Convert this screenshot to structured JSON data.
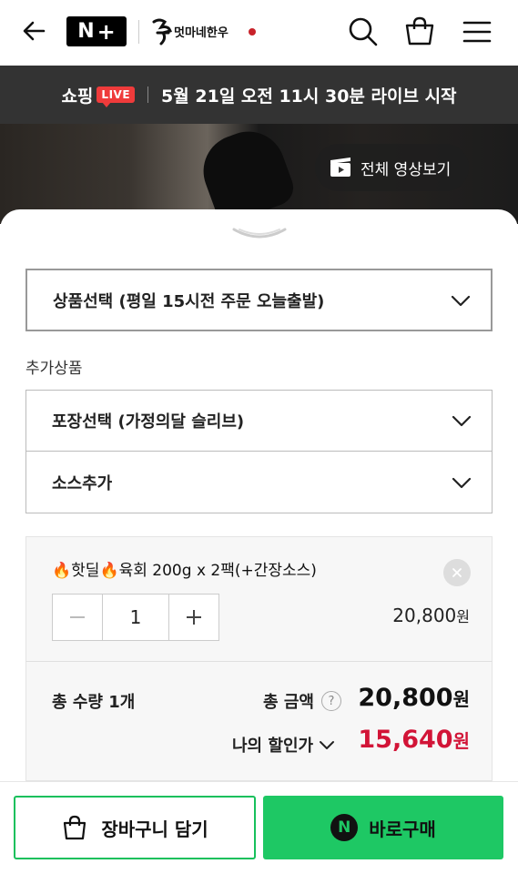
{
  "header": {
    "npay_n": "N",
    "npay_plus": "+",
    "brand_logo_text": "멋마네한우",
    "icons": [
      "back-arrow-icon",
      "search-icon",
      "shopping-bag-icon",
      "hamburger-menu-icon"
    ]
  },
  "live_banner": {
    "shop_label": "쇼핑",
    "live_badge": "LIVE",
    "schedule_text": "5월 21일 오전 11시 30분 라이브 시작"
  },
  "video": {
    "watch_all_label": "전체 영상보기"
  },
  "options": {
    "main_select": "상품선택 (평일 15시전 주문 오늘출발)",
    "addon_label": "추가상품",
    "pack_select": "포장선택 (가정의달 슬리브)",
    "sauce_select": "소스추가"
  },
  "item": {
    "name": "🔥핫딜🔥육회 200g x 2팩(+간장소스)",
    "quantity": "1",
    "price": "20,800",
    "price_unit": "원"
  },
  "summary": {
    "total_qty": "총 수량 1개",
    "total_label": "총 금액",
    "help_glyph": "?",
    "total_amount": "20,800",
    "total_unit": "원",
    "discount_label": "나의 할인가",
    "discount_amount": "15,640",
    "discount_unit": "원"
  },
  "actions": {
    "cart_label": "장바구니 담기",
    "buy_n": "N",
    "buy_label": "바로구매"
  },
  "colors": {
    "naver_green": "#1ec864",
    "discount_red": "#d21437",
    "live_red": "#ef3b3b",
    "banner_bg": "#333333"
  }
}
